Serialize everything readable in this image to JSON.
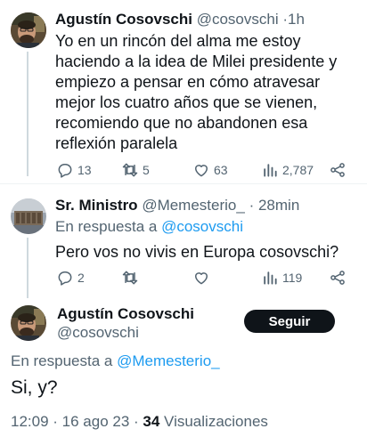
{
  "tweet1": {
    "name": "Agustín Cosovschi",
    "handle": "@cosovschi",
    "dot": "·",
    "time": "1h",
    "text_lines": [
      "Yo en un rincón del alma me estoy",
      "haciendo a la idea de Milei presidente y",
      "empiezo a pensar en cómo atravesar",
      "mejor los cuatro años que se vienen,",
      "recomiendo que no abandonen esa",
      "reflexión paralela"
    ],
    "replies": "13",
    "retweets": "5",
    "likes": "63",
    "views": "2,787"
  },
  "tweet2": {
    "name": "Sr. Ministro",
    "handle": "@Memesterio_",
    "dot": "·",
    "time": "28min",
    "reply_prefix": "En respuesta a",
    "reply_to": "@cosovschi",
    "text": "Pero vos no vivis en Europa cosovschi?",
    "replies": "2",
    "retweets": "",
    "likes": "",
    "views": "119"
  },
  "tweet3": {
    "name": "Agustín Cosovschi",
    "handle": "@cosovschi",
    "follow_label": "Seguir",
    "reply_prefix": "En respuesta a",
    "reply_to": "@Memesterio_",
    "text": "Si, y?",
    "timestamp": "12:09 · 16 ago 23 · ",
    "views_count": "34",
    "views_label": "Visualizaciones"
  },
  "icons": [
    "reply-icon",
    "retweet-icon",
    "like-icon",
    "views-icon",
    "share-icon"
  ],
  "colors": {
    "text": "#0f1419",
    "muted": "#536471",
    "link": "#1d9bf0",
    "button": "#0f1419"
  }
}
